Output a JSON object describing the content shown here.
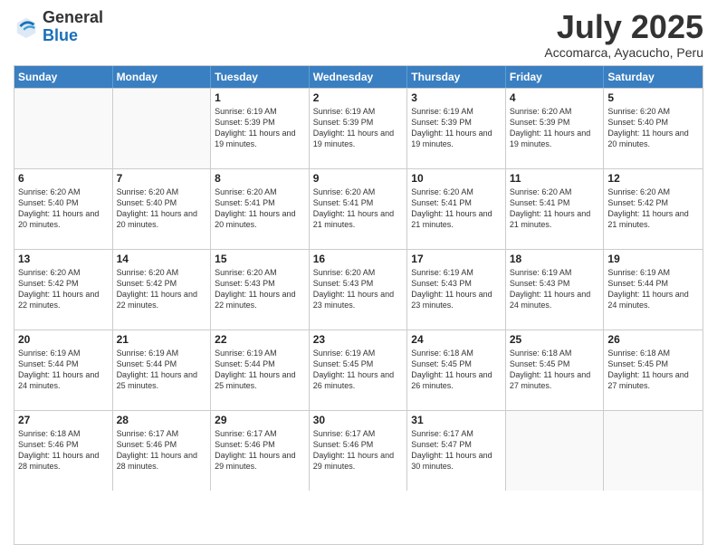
{
  "logo": {
    "general": "General",
    "blue": "Blue"
  },
  "title": "July 2025",
  "subtitle": "Accomarca, Ayacucho, Peru",
  "days": [
    "Sunday",
    "Monday",
    "Tuesday",
    "Wednesday",
    "Thursday",
    "Friday",
    "Saturday"
  ],
  "rows": [
    [
      {
        "day": "",
        "info": ""
      },
      {
        "day": "",
        "info": ""
      },
      {
        "day": "1",
        "info": "Sunrise: 6:19 AM\nSunset: 5:39 PM\nDaylight: 11 hours and 19 minutes."
      },
      {
        "day": "2",
        "info": "Sunrise: 6:19 AM\nSunset: 5:39 PM\nDaylight: 11 hours and 19 minutes."
      },
      {
        "day": "3",
        "info": "Sunrise: 6:19 AM\nSunset: 5:39 PM\nDaylight: 11 hours and 19 minutes."
      },
      {
        "day": "4",
        "info": "Sunrise: 6:20 AM\nSunset: 5:39 PM\nDaylight: 11 hours and 19 minutes."
      },
      {
        "day": "5",
        "info": "Sunrise: 6:20 AM\nSunset: 5:40 PM\nDaylight: 11 hours and 20 minutes."
      }
    ],
    [
      {
        "day": "6",
        "info": "Sunrise: 6:20 AM\nSunset: 5:40 PM\nDaylight: 11 hours and 20 minutes."
      },
      {
        "day": "7",
        "info": "Sunrise: 6:20 AM\nSunset: 5:40 PM\nDaylight: 11 hours and 20 minutes."
      },
      {
        "day": "8",
        "info": "Sunrise: 6:20 AM\nSunset: 5:41 PM\nDaylight: 11 hours and 20 minutes."
      },
      {
        "day": "9",
        "info": "Sunrise: 6:20 AM\nSunset: 5:41 PM\nDaylight: 11 hours and 21 minutes."
      },
      {
        "day": "10",
        "info": "Sunrise: 6:20 AM\nSunset: 5:41 PM\nDaylight: 11 hours and 21 minutes."
      },
      {
        "day": "11",
        "info": "Sunrise: 6:20 AM\nSunset: 5:41 PM\nDaylight: 11 hours and 21 minutes."
      },
      {
        "day": "12",
        "info": "Sunrise: 6:20 AM\nSunset: 5:42 PM\nDaylight: 11 hours and 21 minutes."
      }
    ],
    [
      {
        "day": "13",
        "info": "Sunrise: 6:20 AM\nSunset: 5:42 PM\nDaylight: 11 hours and 22 minutes."
      },
      {
        "day": "14",
        "info": "Sunrise: 6:20 AM\nSunset: 5:42 PM\nDaylight: 11 hours and 22 minutes."
      },
      {
        "day": "15",
        "info": "Sunrise: 6:20 AM\nSunset: 5:43 PM\nDaylight: 11 hours and 22 minutes."
      },
      {
        "day": "16",
        "info": "Sunrise: 6:20 AM\nSunset: 5:43 PM\nDaylight: 11 hours and 23 minutes."
      },
      {
        "day": "17",
        "info": "Sunrise: 6:19 AM\nSunset: 5:43 PM\nDaylight: 11 hours and 23 minutes."
      },
      {
        "day": "18",
        "info": "Sunrise: 6:19 AM\nSunset: 5:43 PM\nDaylight: 11 hours and 24 minutes."
      },
      {
        "day": "19",
        "info": "Sunrise: 6:19 AM\nSunset: 5:44 PM\nDaylight: 11 hours and 24 minutes."
      }
    ],
    [
      {
        "day": "20",
        "info": "Sunrise: 6:19 AM\nSunset: 5:44 PM\nDaylight: 11 hours and 24 minutes."
      },
      {
        "day": "21",
        "info": "Sunrise: 6:19 AM\nSunset: 5:44 PM\nDaylight: 11 hours and 25 minutes."
      },
      {
        "day": "22",
        "info": "Sunrise: 6:19 AM\nSunset: 5:44 PM\nDaylight: 11 hours and 25 minutes."
      },
      {
        "day": "23",
        "info": "Sunrise: 6:19 AM\nSunset: 5:45 PM\nDaylight: 11 hours and 26 minutes."
      },
      {
        "day": "24",
        "info": "Sunrise: 6:18 AM\nSunset: 5:45 PM\nDaylight: 11 hours and 26 minutes."
      },
      {
        "day": "25",
        "info": "Sunrise: 6:18 AM\nSunset: 5:45 PM\nDaylight: 11 hours and 27 minutes."
      },
      {
        "day": "26",
        "info": "Sunrise: 6:18 AM\nSunset: 5:45 PM\nDaylight: 11 hours and 27 minutes."
      }
    ],
    [
      {
        "day": "27",
        "info": "Sunrise: 6:18 AM\nSunset: 5:46 PM\nDaylight: 11 hours and 28 minutes."
      },
      {
        "day": "28",
        "info": "Sunrise: 6:17 AM\nSunset: 5:46 PM\nDaylight: 11 hours and 28 minutes."
      },
      {
        "day": "29",
        "info": "Sunrise: 6:17 AM\nSunset: 5:46 PM\nDaylight: 11 hours and 29 minutes."
      },
      {
        "day": "30",
        "info": "Sunrise: 6:17 AM\nSunset: 5:46 PM\nDaylight: 11 hours and 29 minutes."
      },
      {
        "day": "31",
        "info": "Sunrise: 6:17 AM\nSunset: 5:47 PM\nDaylight: 11 hours and 30 minutes."
      },
      {
        "day": "",
        "info": ""
      },
      {
        "day": "",
        "info": ""
      }
    ]
  ]
}
